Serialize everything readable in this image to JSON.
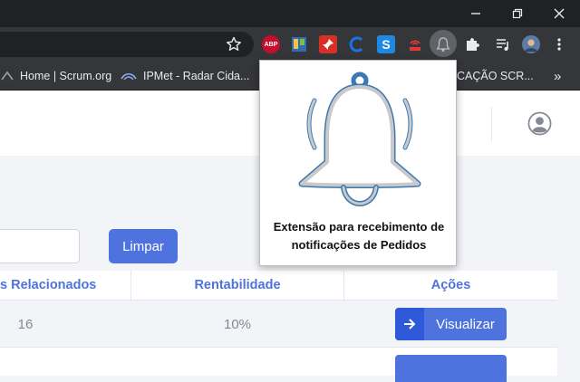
{
  "browser": {
    "bookmarks": [
      {
        "label": "Home | Scrum.org",
        "icon": "scrum-favicon-icon"
      },
      {
        "label": "IPMet - Radar Cida...",
        "icon": "ipmet-favicon-icon"
      },
      {
        "label": "CAÇÃO SCR...",
        "icon": ""
      }
    ],
    "extensions": [
      {
        "name": "abp-extension-icon",
        "text": "ABP",
        "color": "#c70d2c"
      },
      {
        "name": "board-extension-icon",
        "text": "",
        "color": "#2f6db5"
      },
      {
        "name": "pin-extension-icon",
        "text": "",
        "color": "#d93025"
      },
      {
        "name": "c-extension-icon",
        "text": "",
        "color": "#1a73e8"
      },
      {
        "name": "s-extension-icon",
        "text": "S",
        "color": "#1e88e5"
      },
      {
        "name": "radio-extension-icon",
        "text": "",
        "color": "#e53935"
      },
      {
        "name": "bell-extension-icon",
        "text": "",
        "color": "#bdbdbd"
      },
      {
        "name": "puzzle-extension-icon",
        "text": "",
        "color": "#e8eaed"
      }
    ],
    "more_chevron": "»"
  },
  "popup": {
    "text": "Extensão para recebimento de notificações de Pedidos"
  },
  "page": {
    "filter": {
      "value": ""
    },
    "clear_button": "Limpar",
    "table": {
      "headers": [
        "s Relacionados",
        "Rentabilidade",
        "Ações"
      ],
      "rows": [
        {
          "related": "16",
          "profit": "10%",
          "action": "Visualizar"
        }
      ]
    }
  },
  "colors": {
    "primary": "#4e73df",
    "header_text": "#4e73df",
    "cell_text": "#858796"
  }
}
